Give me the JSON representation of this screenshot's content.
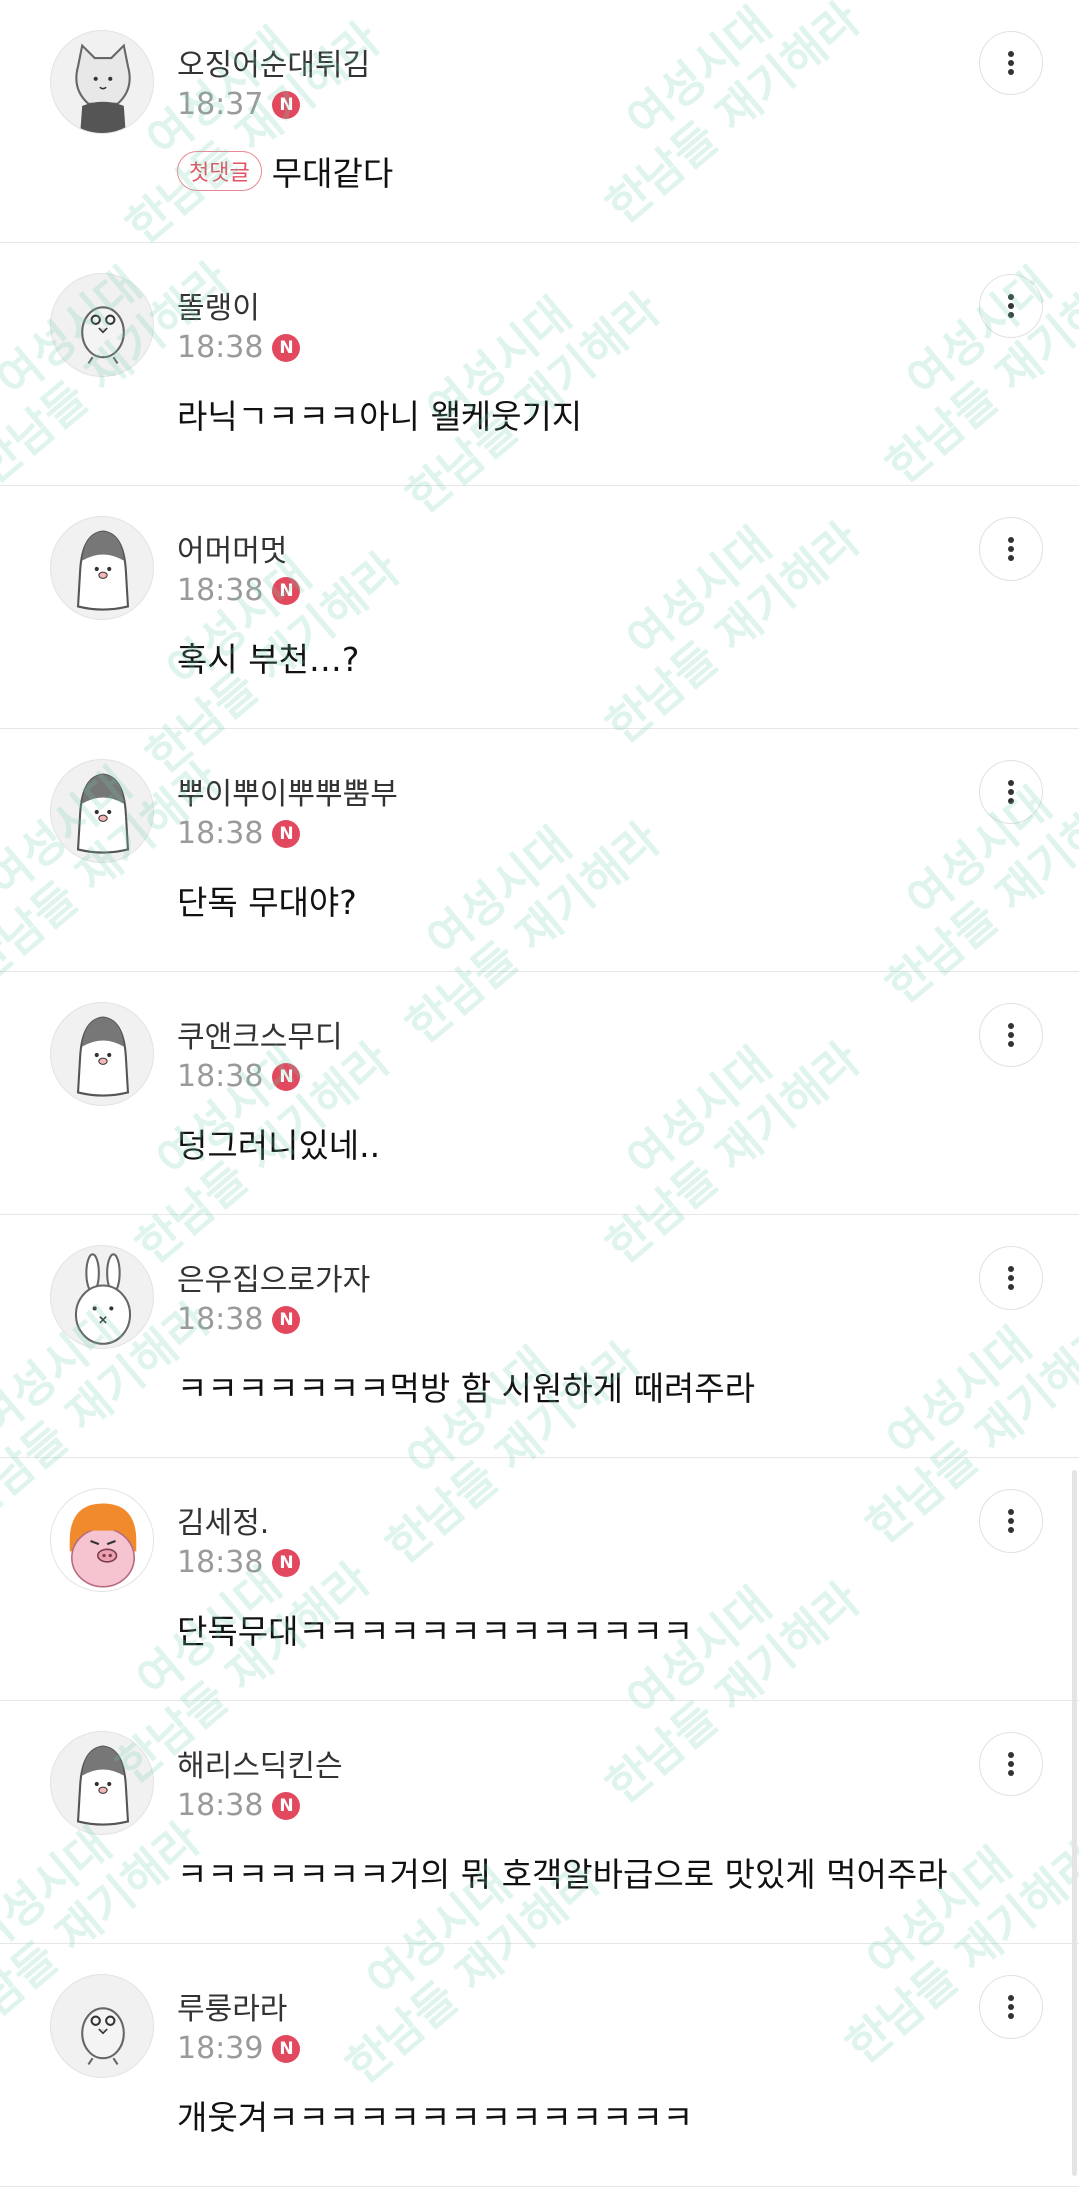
{
  "comments": [
    {
      "nickname": "오징어순대튀김",
      "time": "18:37",
      "new_badge": "N",
      "first_badge": "첫댓글",
      "text": "무대같다",
      "avatar": "cat-avatar"
    },
    {
      "nickname": "똘랭이",
      "time": "18:38",
      "new_badge": "N",
      "text": "라닉ㄱㅋㅋㅋ아니 왤케웃기지",
      "avatar": "bird-avatar"
    },
    {
      "nickname": "어머머멋",
      "time": "18:38",
      "new_badge": "N",
      "text": "혹시 부천…?",
      "avatar": "penguin-avatar"
    },
    {
      "nickname": "뿌이뿌이뿌뿌뿜부",
      "time": "18:38",
      "new_badge": "N",
      "text": "단독 무대야?",
      "avatar": "penguin-avatar"
    },
    {
      "nickname": "쿠앤크스무디",
      "time": "18:38",
      "new_badge": "N",
      "text": "덩그러니있네..",
      "avatar": "penguin-avatar"
    },
    {
      "nickname": "은우집으로가자",
      "time": "18:38",
      "new_badge": "N",
      "text": "ㅋㅋㅋㅋㅋㅋㅋ먹방 함 시원하게 때려주라",
      "avatar": "rabbit-avatar"
    },
    {
      "nickname": "김세정.",
      "time": "18:38",
      "new_badge": "N",
      "text": "단독무대ㅋㅋㅋㅋㅋㅋㅋㅋㅋㅋㅋㅋㅋ",
      "avatar": "pig-avatar"
    },
    {
      "nickname": "해리스딕킨슨",
      "time": "18:38",
      "new_badge": "N",
      "text": "ㅋㅋㅋㅋㅋㅋㅋ거의 뭐 호객알바급으로 맛있게 먹어주라",
      "avatar": "penguin-avatar"
    },
    {
      "nickname": "루룽라라",
      "time": "18:39",
      "new_badge": "N",
      "text": "개웃겨ㅋㅋㅋㅋㅋㅋㅋㅋㅋㅋㅋㅋㅋㅋ",
      "avatar": "bird-avatar"
    }
  ],
  "watermark": {
    "line1": "여성시대",
    "line2": "한남들 재기해라"
  },
  "colors": {
    "new_badge": "#e2495f",
    "first_badge": "#e05463",
    "watermark": "#6ecdaf"
  },
  "icons": {
    "more": "more-vertical-icon"
  }
}
